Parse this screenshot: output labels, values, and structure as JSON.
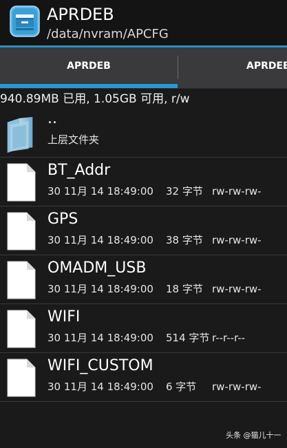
{
  "header": {
    "title": "APRDEB",
    "path": "/data/nvram/APCFG",
    "icon": "file-manager-app-icon"
  },
  "tabs": [
    {
      "label": "APRDEB",
      "selected": true
    },
    {
      "label": "APRDEB",
      "selected": false
    }
  ],
  "storage_info": "940.89MB 已用, 1.05GB 可用, r/w",
  "parent": {
    "name": "..",
    "label": "上层文件夹",
    "icon": "folder-icon"
  },
  "files": [
    {
      "name": "BT_Addr",
      "date": "30 11月 14 18:49:00",
      "size": "32 字节",
      "perms": "rw-rw-rw-",
      "icon": "file-icon"
    },
    {
      "name": "GPS",
      "date": "30 11月 14 18:49:00",
      "size": "38 字节",
      "perms": "rw-rw-rw-",
      "icon": "file-icon"
    },
    {
      "name": "OMADM_USB",
      "date": "30 11月 14 18:49:00",
      "size": "18 字节",
      "perms": "rw-rw-rw-",
      "icon": "file-icon"
    },
    {
      "name": "WIFI",
      "date": "30 11月 14 18:49:00",
      "size": "514 字节",
      "perms": "r--r--r--",
      "icon": "file-icon"
    },
    {
      "name": "WIFI_CUSTOM",
      "date": "30 11月 14 18:49:00",
      "size": "6 字节",
      "perms": "rw-rw-rw-",
      "icon": "file-icon"
    }
  ],
  "watermark": "头条 @猫儿十一",
  "colors": {
    "background": "#1a1a1b",
    "accent": "#2a98d4",
    "tabbar": "#3a3a3c"
  }
}
